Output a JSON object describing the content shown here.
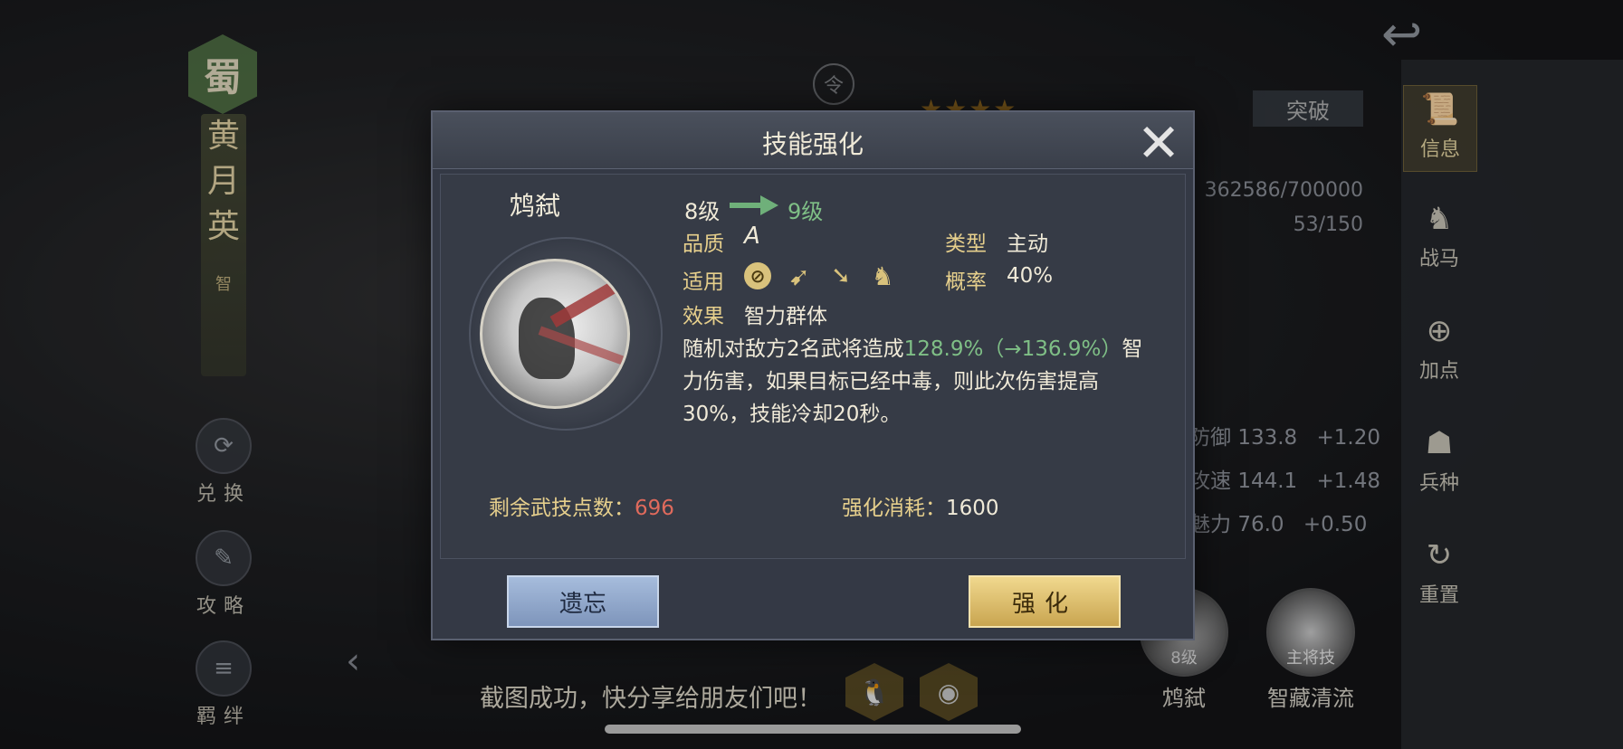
{
  "background": {
    "faction": "蜀",
    "hero_name_chars": [
      "黄",
      "月",
      "英"
    ],
    "hero_class": "智",
    "left_menu": [
      {
        "label": "兑换",
        "icon": "exchange-icon"
      },
      {
        "label": "攻略",
        "icon": "scroll-icon"
      },
      {
        "label": "羁绊",
        "icon": "bond-icon"
      }
    ],
    "ling": "令",
    "stars": "★★★★",
    "breakthrough": "突破",
    "exp": "362586/700000",
    "level_progress": "53/150",
    "attributes": [
      {
        "name": "防御",
        "value": "133.8",
        "bonus": "+1.20"
      },
      {
        "name": "攻速",
        "value": "144.1",
        "bonus": "+1.48"
      },
      {
        "name": "魅力",
        "value": "76.0",
        "bonus": "+0.50"
      }
    ],
    "sidebar": [
      {
        "label": "信息",
        "icon": "scroll-icon",
        "active": true
      },
      {
        "label": "战马",
        "icon": "horse-icon",
        "active": false
      },
      {
        "label": "加点",
        "icon": "add-point-icon",
        "active": false
      },
      {
        "label": "兵种",
        "icon": "soldier-icon",
        "active": false
      },
      {
        "label": "重置",
        "icon": "reset-icon",
        "active": false
      }
    ],
    "bottom_skills": [
      {
        "name": "鸩弑",
        "level": "8级"
      },
      {
        "name": "智藏清流",
        "level": "主将技"
      }
    ],
    "share_text": "截图成功，快分享给朋友们吧！"
  },
  "dialog": {
    "title": "技能强化",
    "skill_name": "鸩弑",
    "level_from": "8级",
    "level_to": "9级",
    "quality_label": "品质",
    "quality_value": "A",
    "type_label": "类型",
    "type_value": "主动",
    "apply_label": "适用",
    "apply_icons": [
      "shield-weapon-icon",
      "bow-icon",
      "spear-icon",
      "horse-icon"
    ],
    "rate_label": "概率",
    "rate_value": "40%",
    "effect_label": "效果",
    "effect_value": "智力群体",
    "desc_prefix": "随机对敌方2名武将造成",
    "desc_highlight": "128.9%（→136.9%）",
    "desc_suffix": "智力伤害，如果目标已经中毒，则此次伤害提高30%，技能冷却20秒。",
    "remaining_label": "剩余武技点数：",
    "remaining_value": "696",
    "cost_label": "强化消耗：",
    "cost_value": "1600",
    "forget_button": "遗忘",
    "enhance_button": "强化"
  },
  "colors": {
    "gold_label": "#e6cf8c",
    "highlight_green": "#7fbf86",
    "remaining_red": "#e06a5c",
    "enhance_button": "#e3c46e",
    "forget_button": "#93a9cc"
  }
}
